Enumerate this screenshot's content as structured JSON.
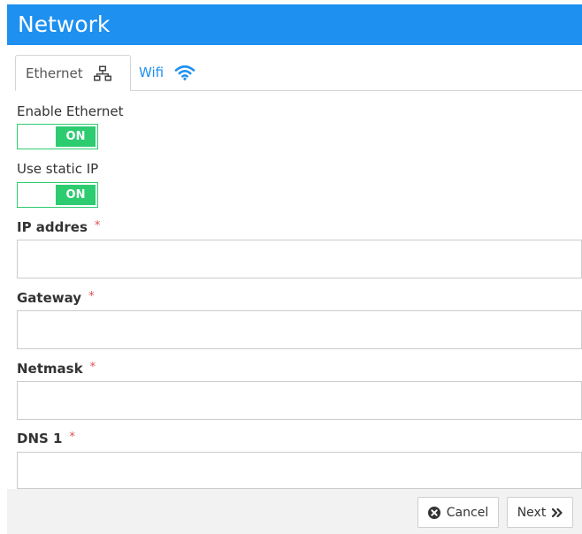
{
  "header": {
    "title": "Network"
  },
  "tabs": [
    {
      "label": "Ethernet",
      "icon": "network-icon",
      "active": true
    },
    {
      "label": "Wifi",
      "icon": "wifi-icon",
      "active": false
    }
  ],
  "form": {
    "enable_ethernet": {
      "label": "Enable Ethernet",
      "state": "ON"
    },
    "use_static_ip": {
      "label": "Use static IP",
      "state": "ON"
    },
    "ip_address": {
      "label": "IP addres",
      "required_mark": "*",
      "value": ""
    },
    "gateway": {
      "label": "Gateway",
      "required_mark": "*",
      "value": ""
    },
    "netmask": {
      "label": "Netmask",
      "required_mark": "*",
      "value": ""
    },
    "dns1": {
      "label": "DNS 1",
      "required_mark": "*",
      "value": ""
    }
  },
  "footer": {
    "cancel_label": "Cancel",
    "next_label": "Next"
  },
  "colors": {
    "accent": "#1e90f0",
    "toggle_on": "#2ecc71",
    "required": "#d9534f"
  }
}
